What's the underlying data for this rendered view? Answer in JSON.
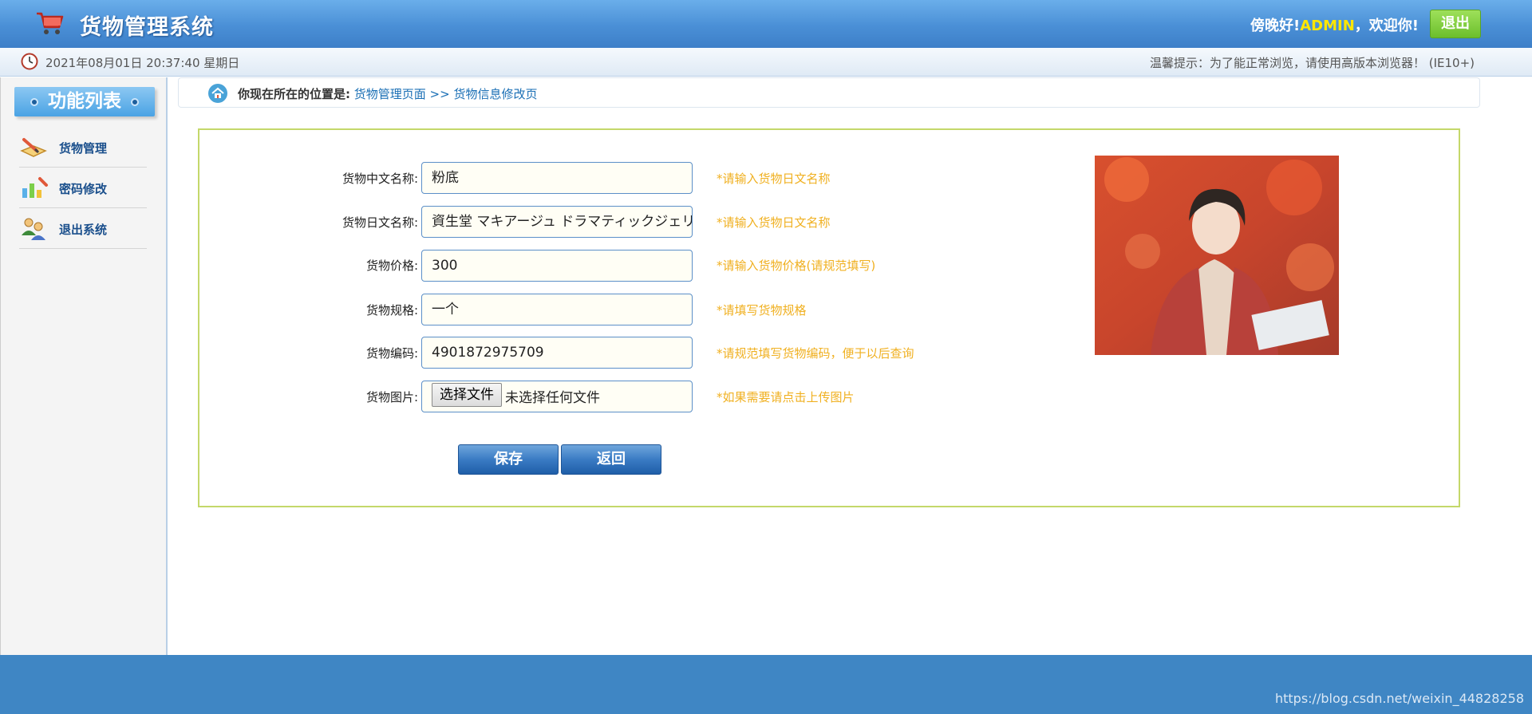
{
  "header": {
    "title": "货物管理系统",
    "greeting_prefix": "傍晚好!",
    "username": "ADMIN",
    "greeting_suffix": "，欢迎你!",
    "logout_label": "退出"
  },
  "subbar": {
    "datetime": "2021年08月01日 20:37:40 星期日",
    "tip": "温馨提示：为了能正常浏览，请使用高版本浏览器！  (IE10+)"
  },
  "sidebar": {
    "title": "功能列表",
    "items": [
      {
        "label": "货物管理",
        "icon": "book-pencil-icon"
      },
      {
        "label": "密码修改",
        "icon": "chart-pencil-icon"
      },
      {
        "label": "退出系统",
        "icon": "users-icon"
      }
    ]
  },
  "breadcrumb": {
    "prefix": "你现在所在的位置是:",
    "path": "货物管理页面 >> 货物信息修改页"
  },
  "form": {
    "fields": [
      {
        "label": "货物中文名称:",
        "value": "粉底",
        "hint": "*请输入货物日文名称"
      },
      {
        "label": "货物日文名称:",
        "value": "資生堂 マキアージュ ドラマティックジェリ",
        "hint": "*请输入货物日文名称"
      },
      {
        "label": "货物价格:",
        "value": "300",
        "hint": "*请输入货物价格(请规范填写)"
      },
      {
        "label": "货物规格:",
        "value": "一个",
        "hint": "*请填写货物规格"
      },
      {
        "label": "货物编码:",
        "value": "4901872975709",
        "hint": "*请规范填写货物编码，便于以后查询"
      },
      {
        "label": "货物图片:",
        "hint": "*如果需要请点击上传图片"
      }
    ],
    "file_button": "选择文件",
    "file_status": "未选择任何文件",
    "save_label": "保存",
    "back_label": "返回"
  },
  "footer": {
    "watermark": "https://blog.csdn.net/weixin_44828258"
  },
  "colors": {
    "header": "#4a8fd6",
    "hint": "#f0b020",
    "panel_border": "#c4d86a",
    "footer": "#3f86c4"
  }
}
